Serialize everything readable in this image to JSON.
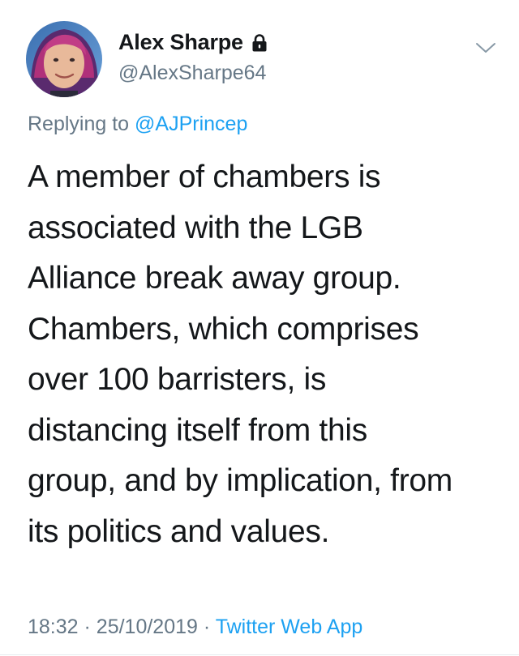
{
  "author": {
    "display_name": "Alex Sharpe",
    "handle": "@AlexSharpe64",
    "protected_icon": "lock-icon",
    "avatar": "profile-photo"
  },
  "menu_icon": "chevron-down-icon",
  "reply": {
    "prefix": "Replying to",
    "mention": "@AJPrincep"
  },
  "tweet": {
    "lines": [
      "A member of chambers is",
      "associated with the LGB",
      "Alliance break away group.",
      "Chambers, which comprises",
      "over 100 barristers, is",
      "distancing itself from this",
      "group, and by implication, from",
      "its politics and values."
    ]
  },
  "meta": {
    "time": "18:32",
    "separator": "·",
    "date": "25/10/2019",
    "source": "Twitter Web App"
  },
  "colors": {
    "link": "#1da1f2",
    "secondary_text": "#657786",
    "primary_text": "#14171a"
  }
}
